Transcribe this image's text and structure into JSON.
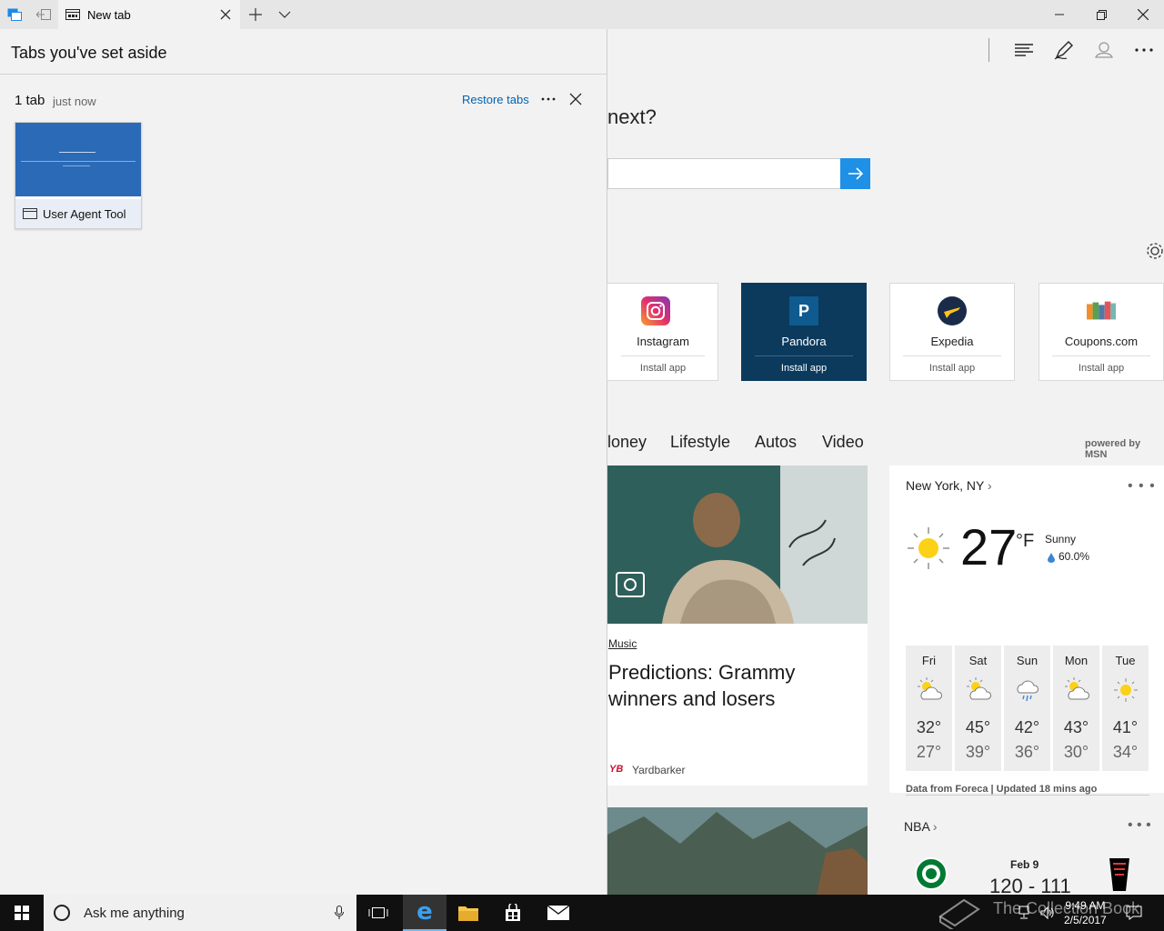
{
  "titlebar": {
    "tab_title": "New tab"
  },
  "aside": {
    "title": "Tabs you've set aside",
    "group_count": "1 tab",
    "group_time": "just now",
    "restore_label": "Restore tabs",
    "thumb_label": "User Agent Tool"
  },
  "search": {
    "question_fragment": "next?"
  },
  "apps": [
    {
      "name": "Instagram",
      "install": "Install app"
    },
    {
      "name": "Pandora",
      "install": "Install app",
      "icon_letter": "P"
    },
    {
      "name": "Expedia",
      "install": "Install app"
    },
    {
      "name": "Coupons.com",
      "install": "Install app"
    }
  ],
  "categories": [
    "Money",
    "Lifestyle",
    "Autos",
    "Video"
  ],
  "categories_visible": [
    "loney",
    "Lifestyle",
    "Autos",
    "Video"
  ],
  "powered_by": "powered by MSN",
  "news": {
    "tag": "Music",
    "title": "Predictions: Grammy winners and losers",
    "source": "Yardbarker",
    "source_badge": "YB"
  },
  "weather": {
    "location": "New York, NY",
    "temp": "27",
    "unit": "°F",
    "condition": "Sunny",
    "precip": "60.0%",
    "days": [
      {
        "name": "Fri",
        "hi": "32°",
        "lo": "27°",
        "icon": "partly-sunny-icon"
      },
      {
        "name": "Sat",
        "hi": "45°",
        "lo": "39°",
        "icon": "partly-sunny-icon"
      },
      {
        "name": "Sun",
        "hi": "42°",
        "lo": "36°",
        "icon": "rain-icon"
      },
      {
        "name": "Mon",
        "hi": "43°",
        "lo": "30°",
        "icon": "partly-sunny-icon"
      },
      {
        "name": "Tue",
        "hi": "41°",
        "lo": "34°",
        "icon": "sun-icon"
      }
    ],
    "data_source": "Data from Foreca | Updated 18 mins ago"
  },
  "nba": {
    "title": "NBA",
    "date": "Feb 9",
    "score": "120 - 111"
  },
  "taskbar": {
    "search_placeholder": "Ask me anything",
    "time": "9:49 AM",
    "date": "2/5/2017",
    "watermark": "The Collection Book"
  },
  "colors": {
    "accent": "#0063b1",
    "search_button": "#1e90e6",
    "pandora_tile": "#0b3a5d",
    "taskbar": "#101010"
  }
}
